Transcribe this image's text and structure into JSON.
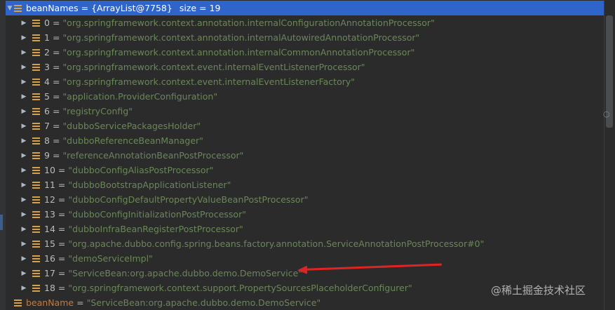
{
  "root": {
    "name": "beanNames",
    "value": "{ArrayList@7758}",
    "size_text": "size = 19"
  },
  "items": [
    {
      "index": "0",
      "value": "\"org.springframework.context.annotation.internalConfigurationAnnotationProcessor\""
    },
    {
      "index": "1",
      "value": "\"org.springframework.context.annotation.internalAutowiredAnnotationProcessor\""
    },
    {
      "index": "2",
      "value": "\"org.springframework.context.annotation.internalCommonAnnotationProcessor\""
    },
    {
      "index": "3",
      "value": "\"org.springframework.context.event.internalEventListenerProcessor\""
    },
    {
      "index": "4",
      "value": "\"org.springframework.context.event.internalEventListenerFactory\""
    },
    {
      "index": "5",
      "value": "\"application.ProviderConfiguration\""
    },
    {
      "index": "6",
      "value": "\"registryConfig\""
    },
    {
      "index": "7",
      "value": "\"dubboServicePackagesHolder\""
    },
    {
      "index": "8",
      "value": "\"dubboReferenceBeanManager\""
    },
    {
      "index": "9",
      "value": "\"referenceAnnotationBeanPostProcessor\""
    },
    {
      "index": "10",
      "value": "\"dubboConfigAliasPostProcessor\""
    },
    {
      "index": "11",
      "value": "\"dubboBootstrapApplicationListener\""
    },
    {
      "index": "12",
      "value": "\"dubboConfigDefaultPropertyValueBeanPostProcessor\""
    },
    {
      "index": "13",
      "value": "\"dubboConfigInitializationPostProcessor\""
    },
    {
      "index": "14",
      "value": "\"dubboInfraBeanRegisterPostProcessor\""
    },
    {
      "index": "15",
      "value": "\"org.apache.dubbo.config.spring.beans.factory.annotation.ServiceAnnotationPostProcessor#0\""
    },
    {
      "index": "16",
      "value": "\"demoServiceImpl\""
    },
    {
      "index": "17",
      "value": "\"ServiceBean:org.apache.dubbo.demo.DemoService\""
    },
    {
      "index": "18",
      "value": "\"org.springframework.context.support.PropertySourcesPlaceholderConfigurer\""
    }
  ],
  "footer": {
    "name": "beanName",
    "value": "\"ServiceBean:org.apache.dubbo.demo.DemoService\""
  },
  "watermark": "@稀土掘金技术社区",
  "icons": {
    "expanded": "chevron-down-icon",
    "collapsed": "chevron-right-icon",
    "field": "field-icon"
  },
  "colors": {
    "selection": "#2f65ca",
    "string": "#6a8759",
    "field_name": "#cc7832",
    "annotation_arrow": "#e02424"
  }
}
